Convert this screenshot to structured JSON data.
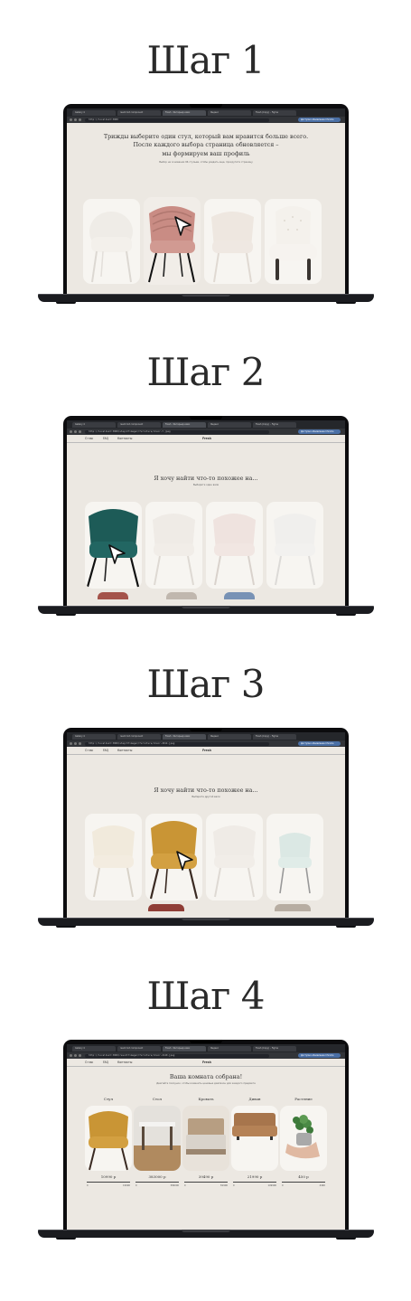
{
  "steps": [
    {
      "title": "Шаг 1",
      "browser": {
        "tabs": [
          "Gallery 4",
          "react-hot component",
          "Fresh · Интерьер-квиз",
          "Яндекс",
          "Fresh (Copy) – Figma"
        ],
        "url": "http://localhost:3000",
        "profile_pill": "Доступно обновление Chrome"
      },
      "page": {
        "heading": "Трижды выберите один стул, который вам нравится больше всего.\nПосле каждого выбора страница обновляется –\nмы формируем ваш профиль",
        "hint": "Выбор на основании 96 стульев, чтобы увидеть еще, прокрутите страницу"
      }
    },
    {
      "title": "Шаг 2",
      "browser": {
        "tabs": [
          "Gallery 4",
          "react-hot component",
          "Fresh · Интерьер-квиз",
          "Яндекс",
          "Fresh (Copy) – Figma"
        ],
        "url": "http://localhost:3000/step/2?image=/furniture/chair-7.jpeg",
        "profile_pill": "Доступно обновление Chrome"
      },
      "nav": {
        "about": "О нас",
        "faq": "FAQ",
        "contacts": "Контакты",
        "brand": "Fresh"
      },
      "page": {
        "heading": "Я хочу найти что-то похожее на...",
        "hint": "Выберите один вали"
      }
    },
    {
      "title": "Шаг 3",
      "browser": {
        "tabs": [
          "Gallery 4",
          "react-hot component",
          "Fresh · Интерьер-квиз",
          "Яндекс",
          "Fresh (Copy) – Figma"
        ],
        "url": "http://localhost:3000/step/3?image=/furniture/chair-2914.jpeg",
        "profile_pill": "Доступно обновление Chrome"
      },
      "nav": {
        "about": "О нас",
        "faq": "FAQ",
        "contacts": "Контакты",
        "brand": "Fresh"
      },
      "page": {
        "heading": "Я хочу найти что-то похожее на...",
        "hint": "Выберите другой вали"
      }
    },
    {
      "title": "Шаг 4",
      "browser": {
        "tabs": [
          "Gallery 4",
          "react-hot component",
          "Fresh · Интерьер-квиз",
          "Яндекс",
          "Fresh (Copy) – Figma"
        ],
        "url": "http://localhost:3000/result?image=/furniture/chair-2140.jpeg",
        "profile_pill": "Доступно обновление Chrome"
      },
      "nav": {
        "about": "О нас",
        "faq": "FAQ",
        "contacts": "Контакты",
        "brand": "Fresh"
      },
      "page": {
        "heading": "Ваша комната собрана!",
        "hint": "Двигайте ползунок, чтобы изменить ценовые диапазон для каждого предмета"
      },
      "results": [
        {
          "category": "Стул",
          "price": "10990 р",
          "min": "0",
          "max": "19990"
        },
        {
          "category": "Стол",
          "price": "383000 р",
          "min": "0",
          "max": "399000"
        },
        {
          "category": "Кровать",
          "price": "39490 р",
          "min": "0",
          "max": "81990"
        },
        {
          "category": "Диван",
          "price": "21990 р",
          "min": "0",
          "max": "149990"
        },
        {
          "category": "Растение",
          "price": "450 р",
          "min": "0",
          "max": "4490"
        }
      ]
    }
  ],
  "colors": {
    "page_bg": "#ece8e2",
    "browser_chrome": "#25272b",
    "laptop_body": "#1b1c20",
    "accent_blue": "#4a6fa5"
  }
}
